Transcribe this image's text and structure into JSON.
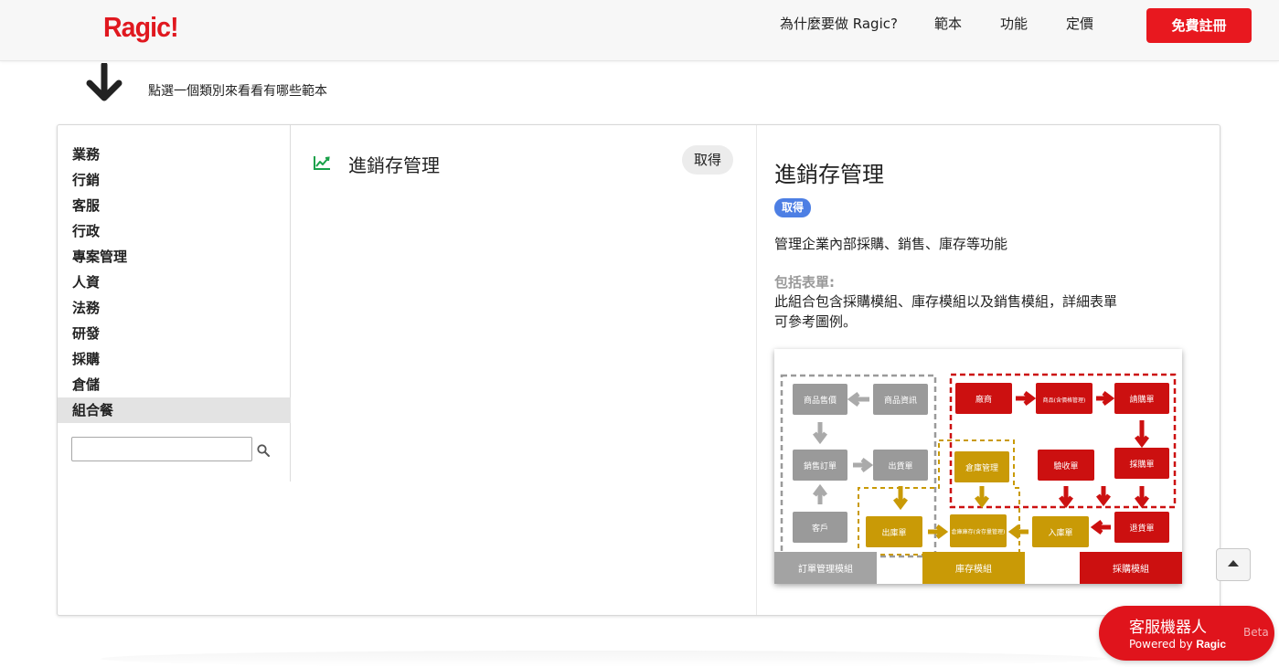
{
  "header": {
    "logo": "Ragic!",
    "nav": [
      "為什麼要做 Ragic?",
      "範本",
      "功能",
      "定價"
    ],
    "signup_label": "免費註冊"
  },
  "hint": {
    "text": "點選一個類別來看看有哪些範本",
    "icon": "arrow-down-icon"
  },
  "categories": {
    "items": [
      "業務",
      "行銷",
      "客服",
      "行政",
      "專案管理",
      "人資",
      "法務",
      "研發",
      "採購",
      "倉儲",
      "組合餐"
    ],
    "active": "組合餐",
    "search_value": "",
    "search_icon": "search-icon"
  },
  "template_list": {
    "items": [
      {
        "icon": "line-chart-icon",
        "title": "進銷存管理",
        "action": "取得"
      }
    ]
  },
  "detail": {
    "title": "進銷存管理",
    "badge": "取得",
    "description": "管理企業內部採購、銷售、庫存等功能",
    "includes_label": "包括表單:",
    "includes_text_line1": "此組合包含採購模組、庫存模組以及銷售模組，詳細表單",
    "includes_text_line2": "可參考圖例。",
    "diagram": {
      "gray_boxes": [
        "商品售價",
        "商品資訊",
        "銷售訂單",
        "出貨單",
        "客戶"
      ],
      "gold_boxes": [
        "出庫單",
        "倉庫管理",
        "倉庫庫存(含存量管理)",
        "入庫單"
      ],
      "red_boxes": [
        "廠商",
        "商品(含價格管理)",
        "請購單",
        "驗收單",
        "採購單",
        "退貨單"
      ],
      "footer_labels": [
        "訂單管理模組",
        "庫存模組",
        "採購模組"
      ],
      "colors": {
        "gray": "#9a9a9a",
        "gold": "#c99a06",
        "red": "#cc1010"
      }
    }
  },
  "chatbot": {
    "title": "客服機器人",
    "powered_prefix": "Powered by",
    "powered_brand": "Ragic",
    "beta": "Beta"
  },
  "colors": {
    "brand": "#e8181f",
    "badge": "#4d7fe4",
    "active_row": "#e3e3e3",
    "icon_green": "#1aa14a"
  }
}
